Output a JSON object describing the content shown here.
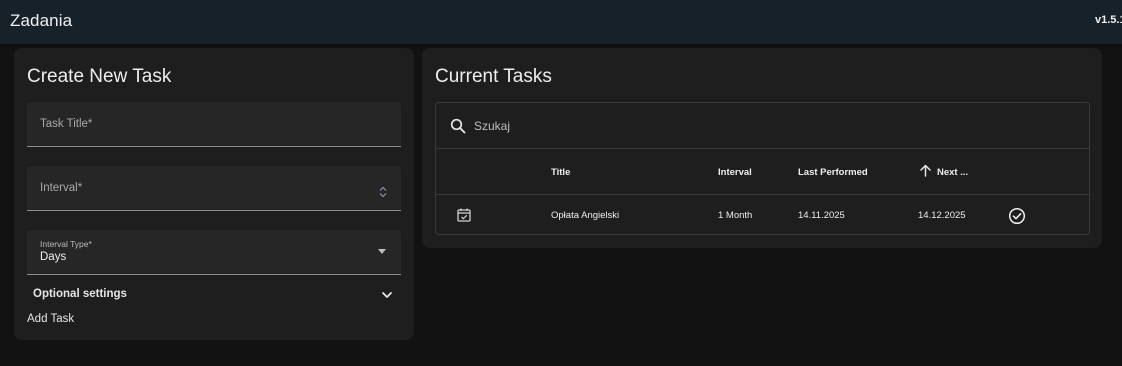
{
  "app": {
    "title": "Zadania",
    "version": "v1.5.1"
  },
  "create_form": {
    "title": "Create New Task",
    "task_title_label": "Task Title*",
    "interval_label": "Interval*",
    "interval_type_label": "Interval Type*",
    "interval_type_value": "Days",
    "optional_settings_label": "Optional settings",
    "add_task_label": "Add Task"
  },
  "tasks": {
    "title": "Current Tasks",
    "search_placeholder": "Szukaj",
    "columns": {
      "title": "Title",
      "interval": "Interval",
      "last_performed": "Last Performed",
      "next": "Next ..."
    },
    "rows": [
      {
        "icon": "calendar-check-icon",
        "title": "Opłata Angielski",
        "interval": "1 Month",
        "last_performed": "14.11.2025",
        "next": "14.12.2025",
        "action_icon": "check-circle-icon"
      }
    ],
    "sort": {
      "column": "next",
      "direction": "ascending"
    }
  },
  "colors": {
    "appbar": "#17212a",
    "background": "#121212",
    "card": "#1e1e1e",
    "field": "#262626",
    "text": "#e6e6e6"
  }
}
